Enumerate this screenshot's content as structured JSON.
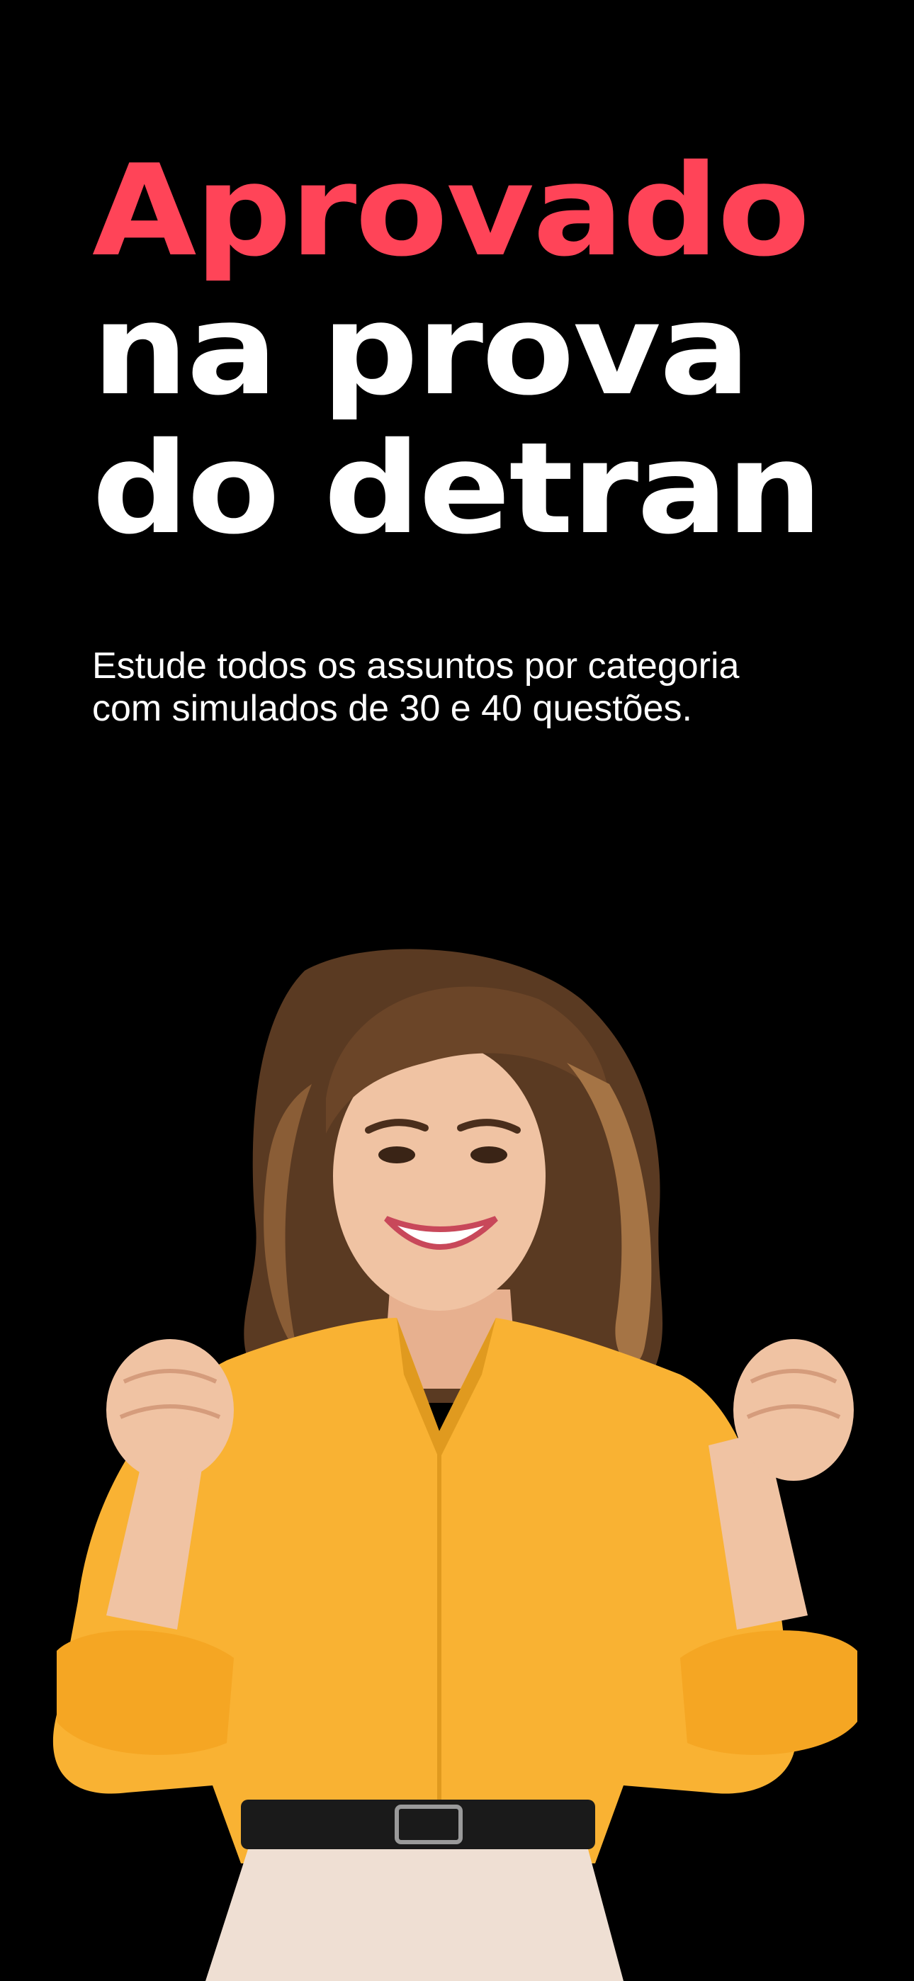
{
  "headline": {
    "line1": "Aprovado",
    "line2": "na prova",
    "line3": "do detran"
  },
  "subtitle": {
    "line1": "Estude todos os assuntos por categoria",
    "line2": "com simulados de 30 e 40 questões."
  },
  "colors": {
    "background": "#000000",
    "accent": "#ff4458",
    "text": "#ffffff",
    "shirt": "#f9b233"
  },
  "hero": {
    "icon": "celebrating-woman-illustration"
  }
}
